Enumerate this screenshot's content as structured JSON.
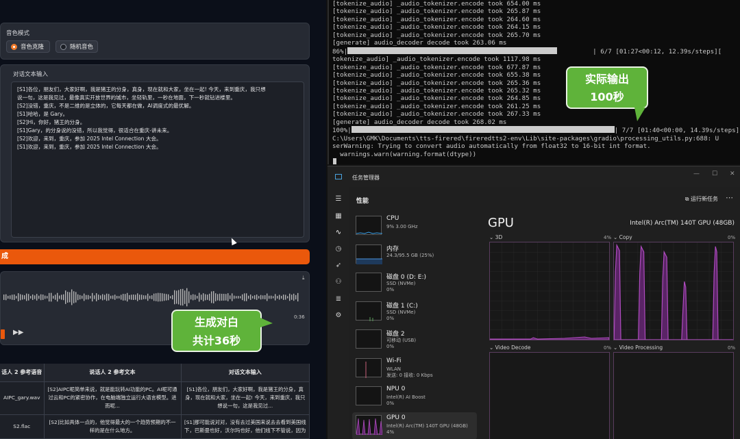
{
  "gradio": {
    "voice_mode_label": "音色模式",
    "voice_options": [
      "音色克隆",
      "随机音色"
    ],
    "voice_selected": "音色克隆",
    "text_input_label": "对话文本输入",
    "text_lines": [
      "[S1]各位，朋友们，大家好啊，我是猪王的分身，真身，现在就和大家，坐在一起! 今天，来到重庆，我只想",
      "说一句，这是我见过，最像真实开放世界的城市，坐轻轨里，一秒在地面，下一秒就钻进楼里。",
      "[S2]没错，重庆，不是二维的是立体的，它每天都在做，AI调度式的最优解。",
      "[S1]哈哈，是 Gary。",
      "[S2]Hi，你好，猪王的分身。",
      "[S1]Gary，的分身说的没错，所以我觉得，很适合在重庆-讲未来。",
      "[S2]欢迎，来到，重庆，参加 2025 Intel Connection 大会。",
      "[S1]欢迎，来到，重庆，参加 2025 Intel Connection 大会。"
    ],
    "generate_button": "成",
    "audio_time": "0:36",
    "download_icon": "download-icon",
    "table_headers": [
      "话人 2 参考语音",
      "说话人 2 参考文本",
      "对话文本输入"
    ],
    "table_rows": [
      [
        "AIPC_gary.wav",
        "[S2]AIPC呢简单来说，就是能玩转AI功能的PC。AI呢可通过云和PC的紧密协作，在电脑端独立运行大语言模型。进而呢...",
        "[S1]各位，朋友们，大家好啊，我是猪王的分身，真身，现在就和大家，坐在一起! 今天，来到重庆，我只想说一句，这是我见过..."
      ],
      [
        "S2.flac",
        "[S2]比如具体一点的，他觉得最大的一个趋势预期的不一样的是在什么地方。",
        "[S1]那可能说对对，没有去过美国来说去去看到美国线下，巴斯曼也好，沃尔玛也好，他们线下不管说，因为深圳出去的还是电子用..."
      ]
    ]
  },
  "callouts": {
    "left_line1": "生成对白",
    "left_line2": "共计36秒",
    "right_line1": "实际输出",
    "right_line2": "100秒"
  },
  "terminal": {
    "lines_top": [
      "[tokenize_audio] _audio_tokenizer.encode took 654.00 ms",
      "[tokenize_audio] _audio_tokenizer.encode took 265.87 ms",
      "[tokenize_audio] _audio_tokenizer.encode took 264.60 ms",
      "[tokenize_audio] _audio_tokenizer.encode took 264.15 ms",
      "[tokenize_audio] _audio_tokenizer.encode took 265.70 ms",
      "[generate] audio_decoder decode took 263.06 ms"
    ],
    "progress1_prefix": "86%|",
    "progress1_suffix": "| 6/7 [01:27<00:12, 12.39s/steps][",
    "lines_mid": [
      "tokenize_audio] _audio_tokenizer.encode took 1117.98 ms",
      "[tokenize_audio] _audio_tokenizer.encode took 677.87 ms",
      "[tokenize_audio] _audio_tokenizer.encode took 655.38 ms",
      "[tokenize_audio] _audio_tokenizer.encode took 265.36 ms",
      "[tokenize_audio] _audio_tokenizer.encode took 265.32 ms",
      "[tokenize_audio] _audio_tokenizer.encode took 264.85 ms",
      "[tokenize_audio] _audio_tokenizer.encode took 261.25 ms",
      "[tokenize_audio] _audio_tokenizer.encode took 267.33 ms",
      "[generate] audio_decoder decode took 268.02 ms"
    ],
    "progress2_prefix": "100%|",
    "progress2_suffix": "| 7/7 [01:40<00:00, 14.39s/steps]",
    "lines_bottom": [
      "C:\\Users\\GMK\\Documents\\tts-firered\\fireredtts2-env\\Lib\\site-packages\\gradio\\processing_utils.py:688: U",
      "serWarning: Trying to convert audio automatically from float32 to 16-bit int format.",
      "  warnings.warn(warning.format(dtype))"
    ]
  },
  "taskmgr": {
    "window_title": "任务管理器",
    "section_title": "性能",
    "new_task": "运行新任务",
    "perf_items": [
      {
        "name": "CPU",
        "sub1": "9% 3.00 GHz",
        "sub2": ""
      },
      {
        "name": "内存",
        "sub1": "24.3/95.5 GB (25%)",
        "sub2": ""
      },
      {
        "name": "磁盘 0 (D: E:)",
        "sub1": "SSD (NVMe)",
        "sub2": "0%"
      },
      {
        "name": "磁盘 1 (C:)",
        "sub1": "SSD (NVMe)",
        "sub2": "0%"
      },
      {
        "name": "磁盘 2",
        "sub1": "可移动 (USB)",
        "sub2": "0%"
      },
      {
        "name": "Wi-Fi",
        "sub1": "WLAN",
        "sub2": "发送: 0 接收: 0 Kbps"
      },
      {
        "name": "NPU 0",
        "sub1": "Intel(R) AI Boost",
        "sub2": "0%"
      },
      {
        "name": "GPU 0",
        "sub1": "Intel(R) Arc(TM) 140T GPU (48GB)",
        "sub2": "4%"
      }
    ],
    "gpu_title": "GPU",
    "gpu_model": "Intel(R) Arc(TM) 140T GPU (48GB)",
    "engines": [
      {
        "name": "3D",
        "pct": "4%"
      },
      {
        "name": "Copy",
        "pct": "0%"
      },
      {
        "name": "Video Decode",
        "pct": "0%"
      },
      {
        "name": "Video Processing",
        "pct": "0%"
      }
    ],
    "colors": {
      "gpu_line": "#b04cc0",
      "gpu_fill": "#5a2466",
      "mem_line": "#4a90d9",
      "cpu_line": "#3aa0e8",
      "wifi_line": "#c8607a"
    }
  }
}
